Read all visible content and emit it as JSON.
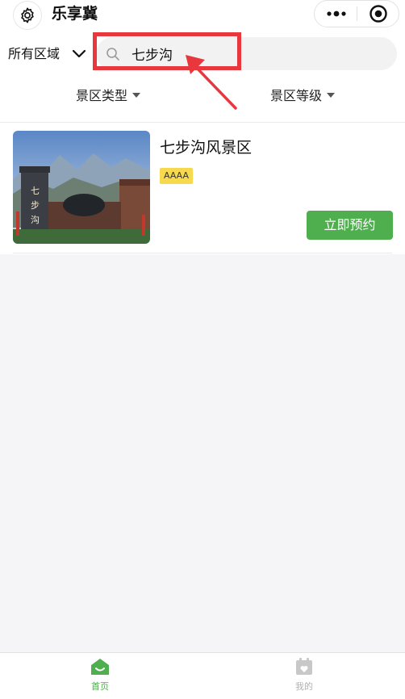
{
  "header": {
    "title": "乐享冀",
    "settings_icon": "gear-icon",
    "more_icon": "more-dots-icon",
    "close_icon": "target-icon"
  },
  "search_bar": {
    "region_label": "所有区域",
    "query": "七步沟",
    "placeholder": ""
  },
  "filters": [
    {
      "label": "景区类型"
    },
    {
      "label": "景区等级"
    }
  ],
  "results": [
    {
      "name": "七步沟风景区",
      "grade": "AAAA",
      "button_label": "立即预约"
    }
  ],
  "tabbar": {
    "items": [
      {
        "label": "首页",
        "icon": "home-icon",
        "active": true
      },
      {
        "label": "我的",
        "icon": "calendar-heart-icon",
        "active": false
      }
    ]
  },
  "colors": {
    "accent": "#4fae4e",
    "highlight": "#e8383d",
    "badge": "#f6d94e",
    "inactive": "#c8c8c8"
  }
}
